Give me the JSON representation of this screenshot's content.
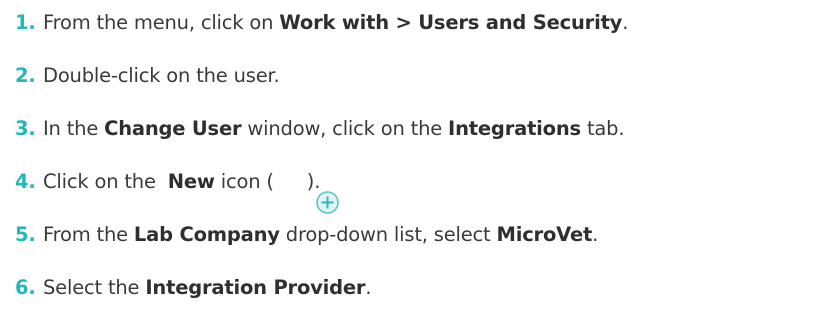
{
  "steps": [
    {
      "number": "1.",
      "parts": [
        "From the menu, click on ",
        "Work with > Users and Security",
        "."
      ]
    },
    {
      "number": "2.",
      "parts": [
        "Double-click on the user."
      ]
    },
    {
      "number": "3.",
      "parts": [
        "In the ",
        "Change User",
        " window, click on the ",
        "Integrations",
        " tab."
      ]
    },
    {
      "number": "4.",
      "parts": [
        "Click on the ",
        "New",
        " icon (",
        "plus-circle-icon",
        ")."
      ]
    },
    {
      "number": "5.",
      "parts": [
        "From the ",
        "Lab Company",
        " drop-down list, select ",
        "MicroVet",
        "."
      ]
    },
    {
      "number": "6.",
      "parts": [
        "Select the ",
        "Integration Provider",
        "."
      ]
    }
  ],
  "colors": {
    "number": "#22b7bd",
    "text": "#3a3a3a",
    "icon_stroke": "#5cc4c8",
    "icon_fill": "#dff4f4"
  }
}
